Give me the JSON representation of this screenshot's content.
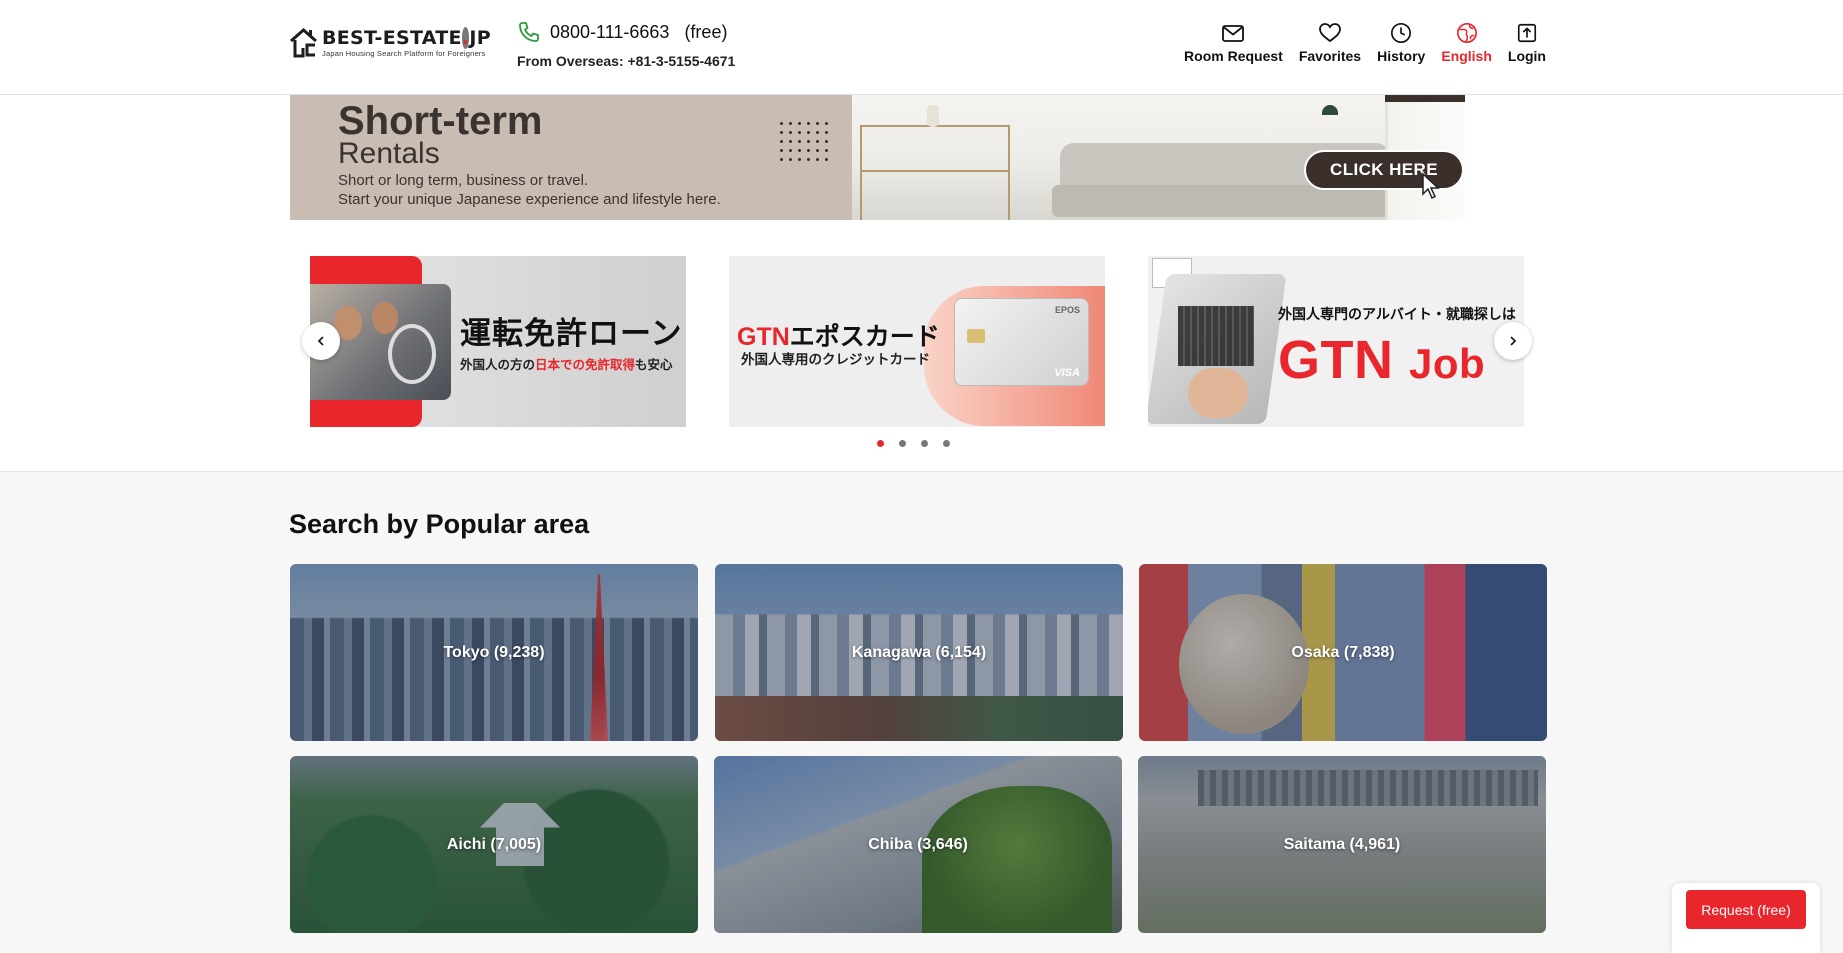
{
  "header": {
    "logo_main": "BEST-ESTATE",
    "logo_dot": ".",
    "logo_tld": "JP",
    "logo_sub": "Japan Housing Search Platform for Foreigners",
    "phone": "0800-111-6663",
    "phone_free": "(free)",
    "overseas": "From Overseas: +81-3-5155-4671",
    "nav": [
      {
        "label": "Room Request",
        "icon": "mail-icon"
      },
      {
        "label": "Favorites",
        "icon": "heart-icon"
      },
      {
        "label": "History",
        "icon": "clock-icon"
      },
      {
        "label": "English",
        "icon": "globe-icon",
        "active": true
      },
      {
        "label": "Login",
        "icon": "upload-icon"
      }
    ]
  },
  "banner": {
    "title": "Short-term",
    "subtitle": "Rentals",
    "desc1": "Short or long term, business or travel.",
    "desc2": "Start your unique Japanese experience and lifestyle here.",
    "cta": "CLICK HERE"
  },
  "carousel": {
    "slides": [
      {
        "title": "運転免許ローン",
        "sub_pre": "外国人の方の",
        "sub_red": "日本での免許取得",
        "sub_post": "も安心"
      },
      {
        "title_red": "GTN",
        "title": "エポスカード",
        "sub": "外国人専用のクレジットカード",
        "card_brand": "EPOS",
        "card_net": "VISA"
      },
      {
        "top": "外国人専門のアルバイト・就職探しは",
        "brand": "GTN",
        "brand2": "Job"
      }
    ],
    "active_index": 0,
    "dot_count": 4
  },
  "popular": {
    "title": "Search by Popular area",
    "areas": [
      {
        "label": "Tokyo (9,238)"
      },
      {
        "label": "Kanagawa (6,154)"
      },
      {
        "label": "Osaka (7,838)"
      },
      {
        "label": "Aichi (7,005)"
      },
      {
        "label": "Chiba (3,646)"
      },
      {
        "label": "Saitama (4,961)"
      }
    ]
  },
  "request_button": "Request (free)",
  "colors": {
    "accent": "#e8262c",
    "banner_brown": "#3b2f2b",
    "phone_green": "#2a9d3a"
  }
}
